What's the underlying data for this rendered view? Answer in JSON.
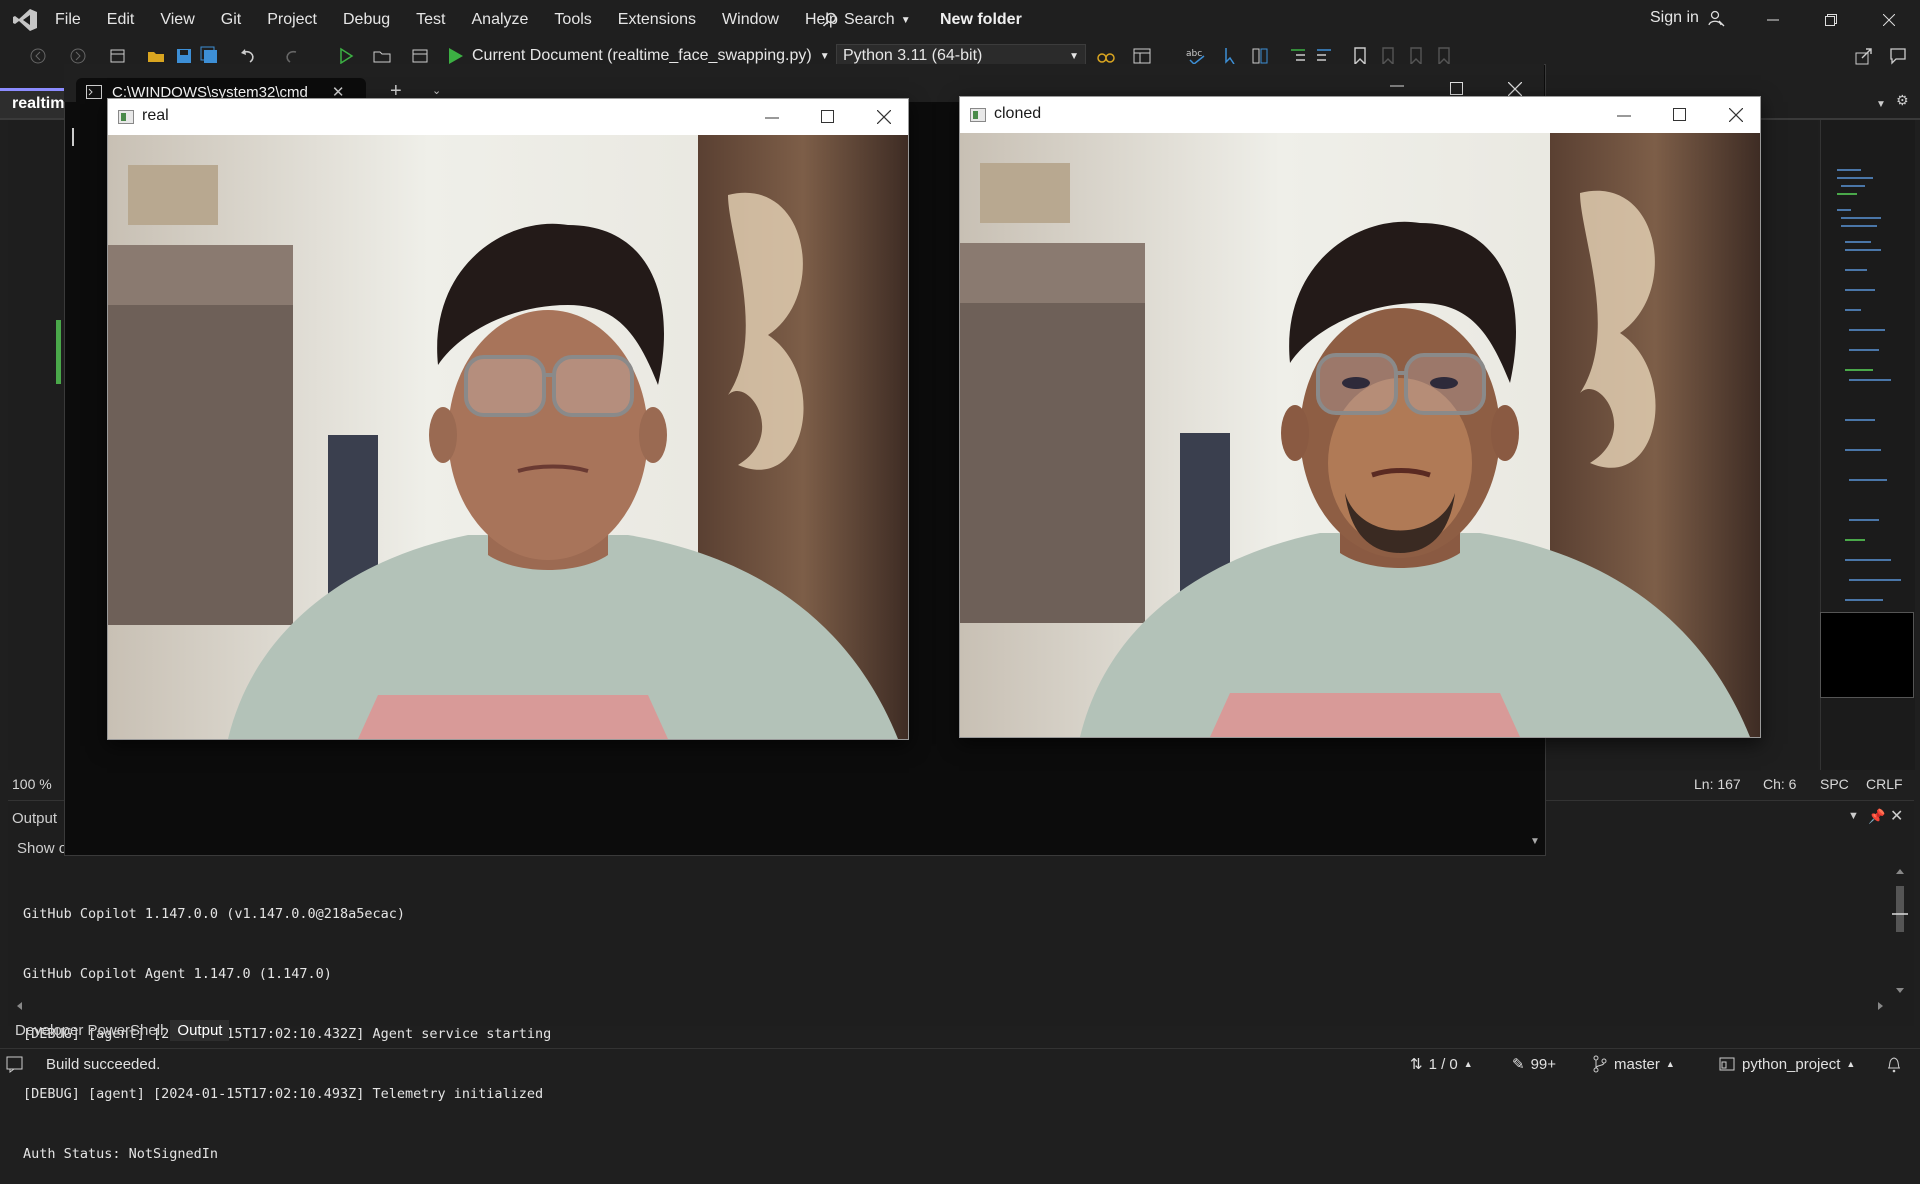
{
  "menubar": {
    "items": [
      "File",
      "Edit",
      "View",
      "Git",
      "Project",
      "Debug",
      "Test",
      "Analyze",
      "Tools",
      "Extensions",
      "Window",
      "Help"
    ],
    "search_label": "Search",
    "folder_title": "New folder",
    "sign_in": "Sign in"
  },
  "toolbar": {
    "run_target": "Current Document (realtime_face_swapping.py)",
    "environment": "Python 3.11 (64-bit)"
  },
  "editor": {
    "tab_label": "realtim",
    "zoom": "100 %",
    "line": "Ln: 167",
    "char": "Ch: 6",
    "whitespace": "SPC",
    "line_ending": "CRLF"
  },
  "cmd": {
    "tab_title": "C:\\WINDOWS\\system32\\cmd"
  },
  "windows": {
    "real_title": "real",
    "cloned_title": "cloned"
  },
  "output": {
    "title": "Output",
    "show_label": "Show o",
    "lines": [
      "GitHub Copilot 1.147.0.0 (v1.147.0.0@218a5ecac)",
      "GitHub Copilot Agent 1.147.0 (1.147.0)",
      "[DEBUG] [agent] [2024-01-15T17:02:10.432Z] Agent service starting",
      "[DEBUG] [agent] [2024-01-15T17:02:10.493Z] Telemetry initialized",
      "Auth Status: NotSignedIn"
    ]
  },
  "bottom_tabs": [
    "Developer PowerShell",
    "Output"
  ],
  "statusbar": {
    "build": "Build succeeded.",
    "sync": "1 / 0",
    "edits": "99+",
    "branch": "master",
    "project": "python_project"
  },
  "colors": {
    "background": "#1f1f1f",
    "accent_green": "#4aa84a",
    "run_green": "#3cb043"
  }
}
